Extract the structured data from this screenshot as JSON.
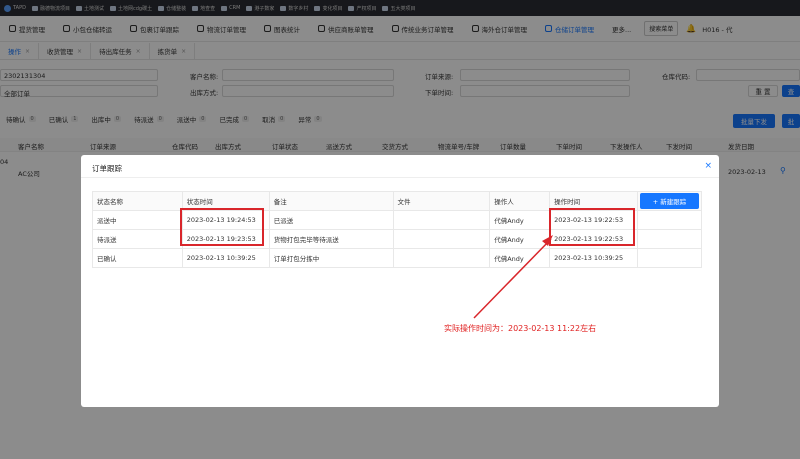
{
  "bookmarks": [
    "TAPD",
    "融德物流项目",
    "土地测试",
    "土地网cdg碳土",
    "仓储整装",
    "地查查",
    "CRM",
    "港子数家",
    "数字乡村",
    "变化项目",
    "产权项目",
    "五大类项目"
  ],
  "topnav": {
    "items": [
      "提货管理",
      "小包仓储转运",
      "包裹订单跟踪",
      "物流订单管理",
      "图表统计",
      "供应商账单管理",
      "传统业务订单管理",
      "海外仓订单管理",
      "仓储订单管理",
      "更多..."
    ],
    "active_index": 8,
    "search_menu": "搜索菜单",
    "user": "H016 - 代"
  },
  "tabs": [
    {
      "label": "操作",
      "active": true
    },
    {
      "label": "收货管理",
      "active": false
    },
    {
      "label": "待出库任务",
      "active": false
    },
    {
      "label": "拣货单",
      "active": false
    }
  ],
  "filters": {
    "order_no_value": "2302131304",
    "order_type_value": "全部订单",
    "customer_label": "客户名称:",
    "outbound_label": "出库方式:",
    "source_label": "订单来源:",
    "order_time_label": "下单时间:",
    "warehouse_label": "仓库代码:",
    "reset": "重 置",
    "search": "查"
  },
  "status_tabs": [
    {
      "label": "待确认",
      "count": "0"
    },
    {
      "label": "已确认",
      "count": "1"
    },
    {
      "label": "出库中",
      "count": "0"
    },
    {
      "label": "待派送",
      "count": "0"
    },
    {
      "label": "派送中",
      "count": "0"
    },
    {
      "label": "已完成",
      "count": "0"
    },
    {
      "label": "取消",
      "count": "0"
    },
    {
      "label": "异常",
      "count": "0"
    }
  ],
  "actions": {
    "batch_dispatch": "批量下发",
    "batch_other": "批"
  },
  "main_table": {
    "headers": [
      "客户名称",
      "订单来源",
      "仓库代码",
      "出库方式",
      "订单状态",
      "派送方式",
      "交货方式",
      "物流单号/车牌",
      "订单数量",
      "下单时间",
      "下发操作人",
      "下发时间",
      "发货日期"
    ],
    "row": {
      "prefix": "04",
      "customer": "AC公司",
      "ship_date": "2023-02-13"
    }
  },
  "modal": {
    "title": "订单跟踪",
    "close": "×",
    "headers": [
      "状态名称",
      "状态时间",
      "备注",
      "文件",
      "操作人",
      "操作时间"
    ],
    "new_button": "+ 新建跟踪",
    "rows": [
      {
        "status": "派送中",
        "status_time": "2023-02-13 19:24:53",
        "remark": "已派送",
        "file": "",
        "operator": "代佛Andy",
        "op_time": "2023-02-13 19:22:53"
      },
      {
        "status": "待派送",
        "status_time": "2023-02-13 19:23:53",
        "remark": "货物打包完毕等待派送",
        "file": "",
        "operator": "代佛Andy",
        "op_time": "2023-02-13 19:22:53"
      },
      {
        "status": "已确认",
        "status_time": "2023-02-13 10:39:25",
        "remark": "订单打包分拣中",
        "file": "",
        "operator": "代佛Andy",
        "op_time": "2023-02-13 10:39:25"
      }
    ]
  },
  "annotation": {
    "text": "实际操作时间为：2023-02-13 11:22左右",
    "color": "#e02020"
  }
}
